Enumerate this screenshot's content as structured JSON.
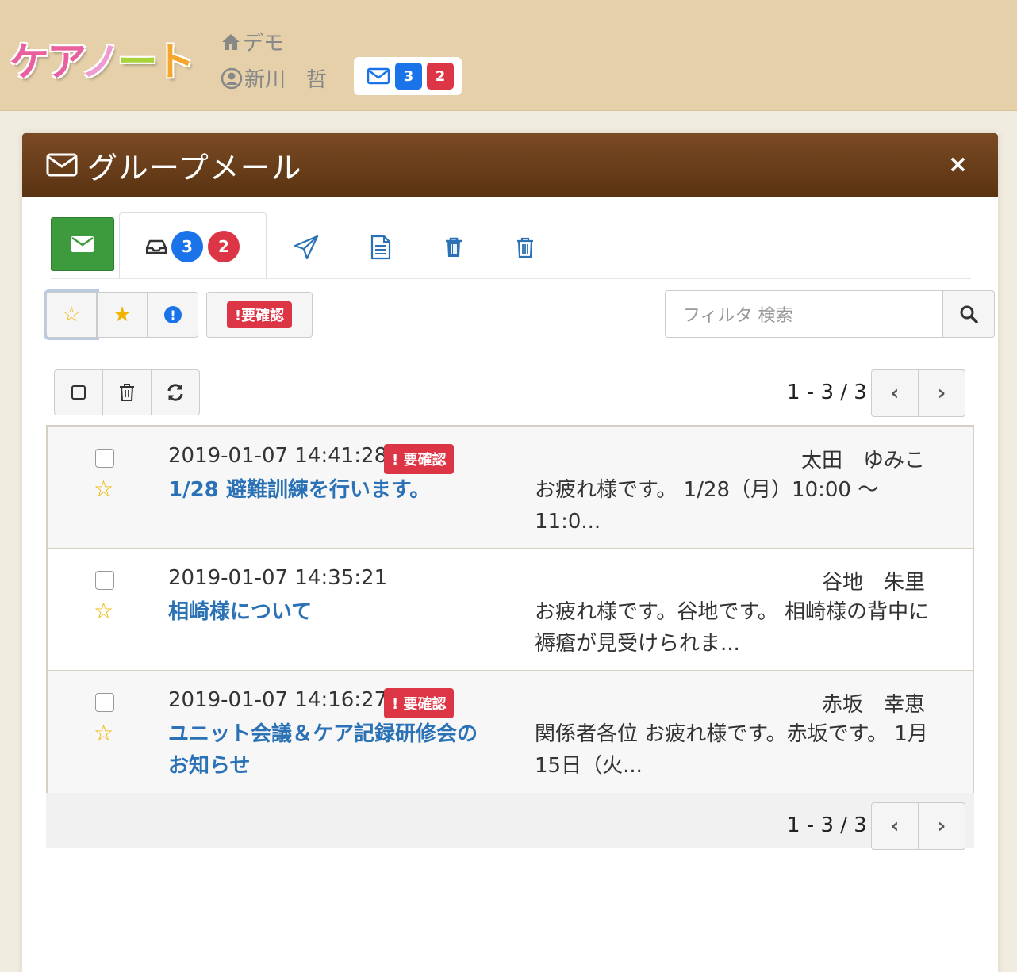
{
  "header": {
    "logo": [
      "ケ",
      "ア",
      "ノ",
      "ー",
      "ト"
    ],
    "facility": "デモ",
    "user": "新川　哲",
    "mail_unread": "3",
    "mail_required": "2"
  },
  "panel": {
    "title": "グループメール",
    "close": "×"
  },
  "tabs": {
    "inbox_unread": "3",
    "inbox_required": "2"
  },
  "filters": {
    "required_label": "!要確認",
    "search_placeholder": "フィルタ 検索"
  },
  "pager": {
    "top": "1 - 3 / 3",
    "bottom": "1 - 3 / 3"
  },
  "messages": [
    {
      "date": "2019-01-07 14:41:28",
      "required": "! 要確認",
      "subject": "1/28 避難訓練を行います。",
      "sender": "太田　ゆみこ",
      "preview": "お疲れ様です。 1/28（月）10:00 〜 11:0..."
    },
    {
      "date": "2019-01-07 14:35:21",
      "required": "",
      "subject": "相崎様について",
      "sender": "谷地　朱里",
      "preview": "お疲れ様です。谷地です。 相崎様の背中に褥瘡が見受けられま..."
    },
    {
      "date": "2019-01-07 14:16:27",
      "required": "! 要確認",
      "subject": "ユニット会議＆ケア記録研修会のお知らせ",
      "sender": "赤坂　幸恵",
      "preview": "関係者各位 お疲れ様です。赤坂です。 1月15日（火..."
    }
  ],
  "icons": {
    "home": "home-icon",
    "user": "user-circle-icon",
    "mail": "envelope-icon",
    "compose": "envelope-icon",
    "inbox": "inbox-icon",
    "sent": "paper-plane-icon",
    "draft": "document-icon",
    "trash": "trash-icon",
    "star": "star-icon",
    "search": "search-icon"
  },
  "colors": {
    "header_bg": "#e5d0a9",
    "panel_head": "#6b3d1b",
    "compose_green": "#3d9b3d",
    "badge_blue": "#1a73e8",
    "badge_red": "#dc3545",
    "link_blue": "#2a72b5",
    "star_yellow": "#f0b400"
  }
}
